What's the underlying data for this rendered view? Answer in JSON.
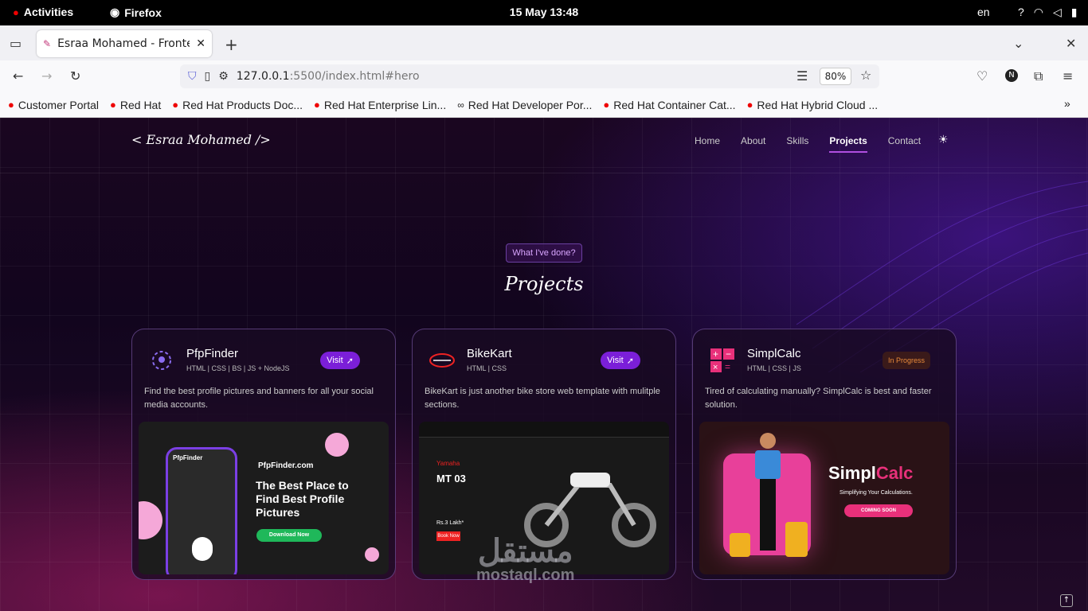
{
  "system_bar": {
    "activities": "Activities",
    "browser": "Firefox",
    "clock": "15 May  13:48",
    "lang": "en"
  },
  "tab": {
    "title": "Esraa Mohamed - Frontend Developer"
  },
  "url": {
    "host": "127.0.0.1",
    "path": ":5500/index.html#hero",
    "zoom": "80%"
  },
  "bookmarks": [
    "Customer Portal",
    "Red Hat",
    "Red Hat Products Doc...",
    "Red Hat Enterprise Lin...",
    "Red Hat Developer Por...",
    "Red Hat Container Cat...",
    "Red Hat Hybrid Cloud ..."
  ],
  "site": {
    "logo": "< Esraa Mohamed />",
    "nav": [
      "Home",
      "About",
      "Skills",
      "Projects",
      "Contact"
    ],
    "badge": "What I've done?",
    "title": "Projects"
  },
  "cards": [
    {
      "name": "PfpFinder",
      "tech": "HTML | CSS | BS | JS + NodeJS",
      "desc": "Find the best profile pictures and banners for all your social media accounts.",
      "action": "Visit",
      "shot": {
        "brand": "PfpFinder.com",
        "headline": "The Best Place to Find Best Profile Pictures",
        "cta": "Download Now",
        "app": "PfpFinder"
      }
    },
    {
      "name": "BikeKart",
      "tech": "HTML | CSS",
      "desc": "BikeKart is just another bike store web template with mulitple sections.",
      "action": "Visit",
      "shot": {
        "brand": "Yamaha",
        "model": "MT 03",
        "price": "Rs.3 Lakh*",
        "cta": "Book Now"
      }
    },
    {
      "name": "SimplCalc",
      "tech": "HTML | CSS | JS",
      "desc": "Tired of calculating manually? SimplCalc is best and faster solution.",
      "action": "In Progress",
      "shot": {
        "title_a": "Simpl",
        "title_b": "Calc",
        "sub": "Simplifying Your Calculations.",
        "cta": "COMING SOON"
      }
    }
  ],
  "watermark": {
    "arabic": "مستقل",
    "latin": "mostaql.com"
  }
}
